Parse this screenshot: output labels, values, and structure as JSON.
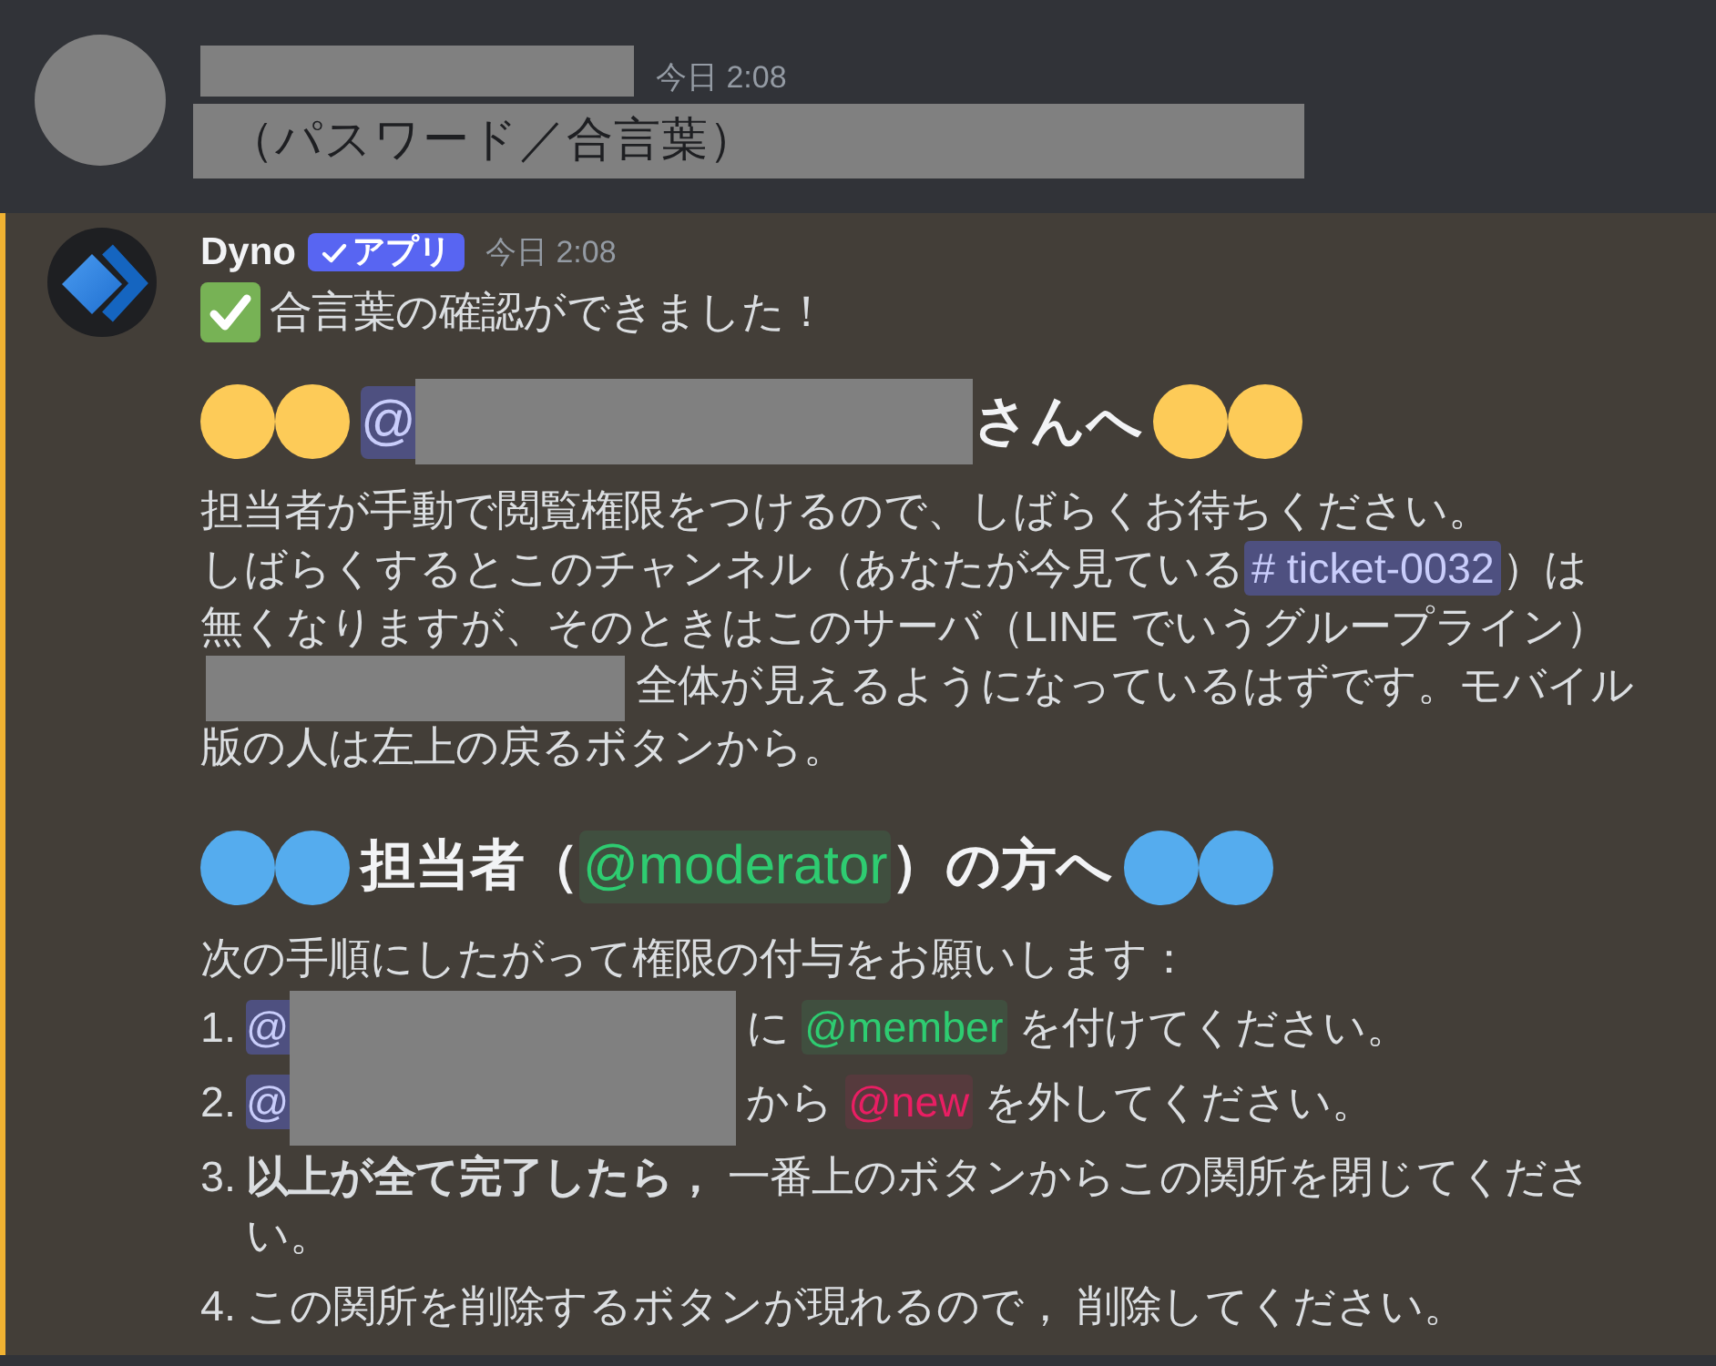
{
  "messages": [
    {
      "kind": "user",
      "mentioned": false,
      "author": {
        "kind": "redacted"
      },
      "timestamp": "今日 2:08",
      "blocks": [
        {
          "kind": "line",
          "segments": [
            {
              "kind": "masked",
              "text": "（パスワード／合言葉）"
            }
          ]
        }
      ]
    },
    {
      "kind": "bot",
      "mentioned": true,
      "author": {
        "kind": "name",
        "text": "Dyno"
      },
      "badge": "アプリ",
      "timestamp": "今日 2:08",
      "blocks": [
        {
          "kind": "line",
          "segments": [
            {
              "kind": "check"
            },
            {
              "kind": "text",
              "text": "合言葉の確認ができました！"
            }
          ]
        },
        {
          "kind": "heading",
          "segments": [
            {
              "kind": "circle",
              "color": "#fdcb58"
            },
            {
              "kind": "circle",
              "color": "#fdcb58"
            },
            {
              "kind": "user",
              "text": "@"
            },
            {
              "kind": "redacted"
            },
            {
              "kind": "text",
              "text": "さんへ"
            },
            {
              "kind": "circle",
              "color": "#fdcb58"
            },
            {
              "kind": "circle",
              "color": "#fdcb58"
            }
          ]
        },
        {
          "kind": "paragraph",
          "lines": [
            [
              {
                "kind": "text",
                "text": "担当者が手動で閲覧権限をつけるので、しばらくお待ちください。"
              }
            ],
            [
              {
                "kind": "text",
                "text": "しばらくするとこのチャンネル（あなたが今見ている"
              },
              {
                "kind": "channel",
                "text": "# ticket-0032"
              },
              {
                "kind": "text",
                "text": "）は"
              }
            ],
            [
              {
                "kind": "text",
                "text": "無くなりますが、そのときはこのサーバ（LINE でいうグループライン）"
              }
            ],
            [
              {
                "kind": "redacted"
              },
              {
                "kind": "text",
                "text": "全体が見えるようになっているはずです。モバイル"
              }
            ],
            [
              {
                "kind": "text",
                "text": "版の人は左上の戻るボタンから。"
              }
            ]
          ]
        },
        {
          "kind": "heading",
          "segments": [
            {
              "kind": "circle",
              "color": "#55acee"
            },
            {
              "kind": "circle",
              "color": "#55acee"
            },
            {
              "kind": "text",
              "text": "担当者（"
            },
            {
              "kind": "role",
              "text": "@moderator",
              "color": "#2ecc71"
            },
            {
              "kind": "text",
              "text": "）の方へ"
            },
            {
              "kind": "circle",
              "color": "#55acee"
            },
            {
              "kind": "circle",
              "color": "#55acee"
            }
          ]
        },
        {
          "kind": "line",
          "segments": [
            {
              "kind": "text",
              "text": "次の手順にしたがって権限の付与をお願いします："
            }
          ]
        },
        {
          "kind": "list",
          "items": [
            {
              "number": "1.",
              "segments": [
                {
                  "kind": "user",
                  "text": "@"
                },
                {
                  "kind": "redacted"
                },
                {
                  "kind": "text",
                  "text": "に"
                },
                {
                  "kind": "role",
                  "text": "@member",
                  "color": "#2ecc71"
                },
                {
                  "kind": "text",
                  "text": "を付けてください。"
                }
              ]
            },
            {
              "number": "2.",
              "segments": [
                {
                  "kind": "user",
                  "text": "@"
                },
                {
                  "kind": "redacted"
                },
                {
                  "kind": "text",
                  "text": "から"
                },
                {
                  "kind": "role",
                  "text": "@new",
                  "color": "#e91e63"
                },
                {
                  "kind": "text",
                  "text": "を外してください。"
                }
              ]
            },
            {
              "number": "3.",
              "segments": [
                {
                  "kind": "text",
                  "text": "**以上が全て完了したら，** 一番上のボタンからこの関所を閉じてください。"
                }
              ]
            },
            {
              "number": "4.",
              "segments": [
                {
                  "kind": "text",
                  "text": "この関所を削除するボタンが現れるので， 削除してください。"
                }
              ]
            }
          ]
        }
      ]
    }
  ]
}
